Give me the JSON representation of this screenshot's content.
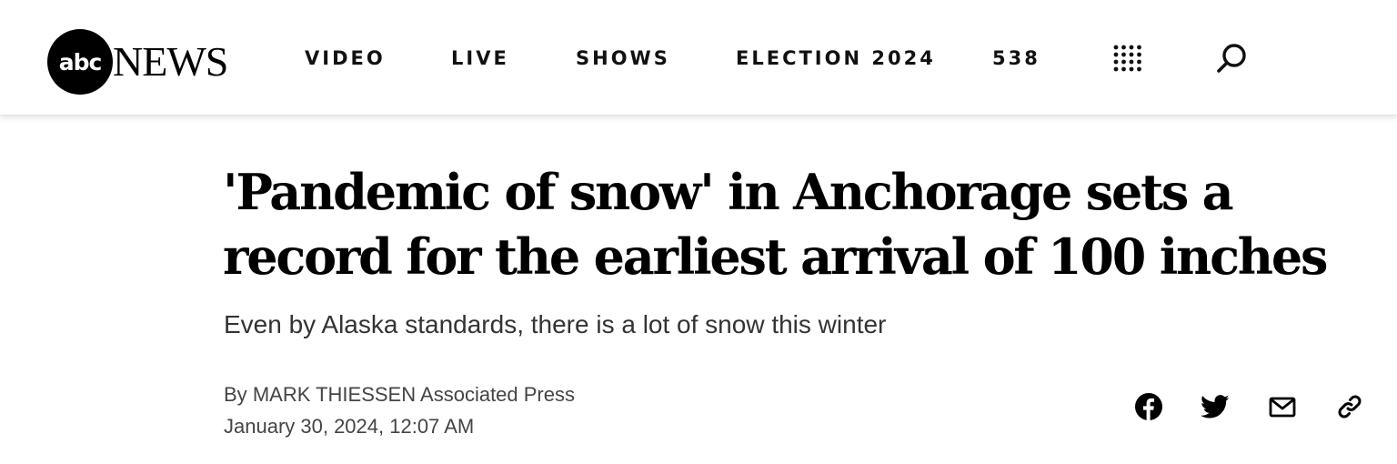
{
  "header": {
    "logo": {
      "abc": "abc",
      "news": "NEWS"
    },
    "nav": [
      {
        "label": "VIDEO"
      },
      {
        "label": "LIVE"
      },
      {
        "label": "SHOWS"
      },
      {
        "label": "ELECTION 2024"
      },
      {
        "label": "538"
      }
    ],
    "icons": {
      "menu": "grid-menu-icon",
      "search": "search-icon"
    }
  },
  "article": {
    "headline": "'Pandemic of snow' in Anchorage sets a record for the earliest arrival of 100 inches",
    "subheadline": "Even by Alaska standards, there is a lot of snow this winter",
    "byline": {
      "prefix": "By",
      "author": "MARK THIESSEN",
      "source": "Associated Press"
    },
    "date": "January 30, 2024, 12:07 AM",
    "share_icons": [
      "facebook-icon",
      "twitter-icon",
      "email-icon",
      "link-icon"
    ]
  },
  "colors": {
    "text": "#000000",
    "subtext": "#333333",
    "meta": "#444444",
    "background": "#ffffff"
  }
}
